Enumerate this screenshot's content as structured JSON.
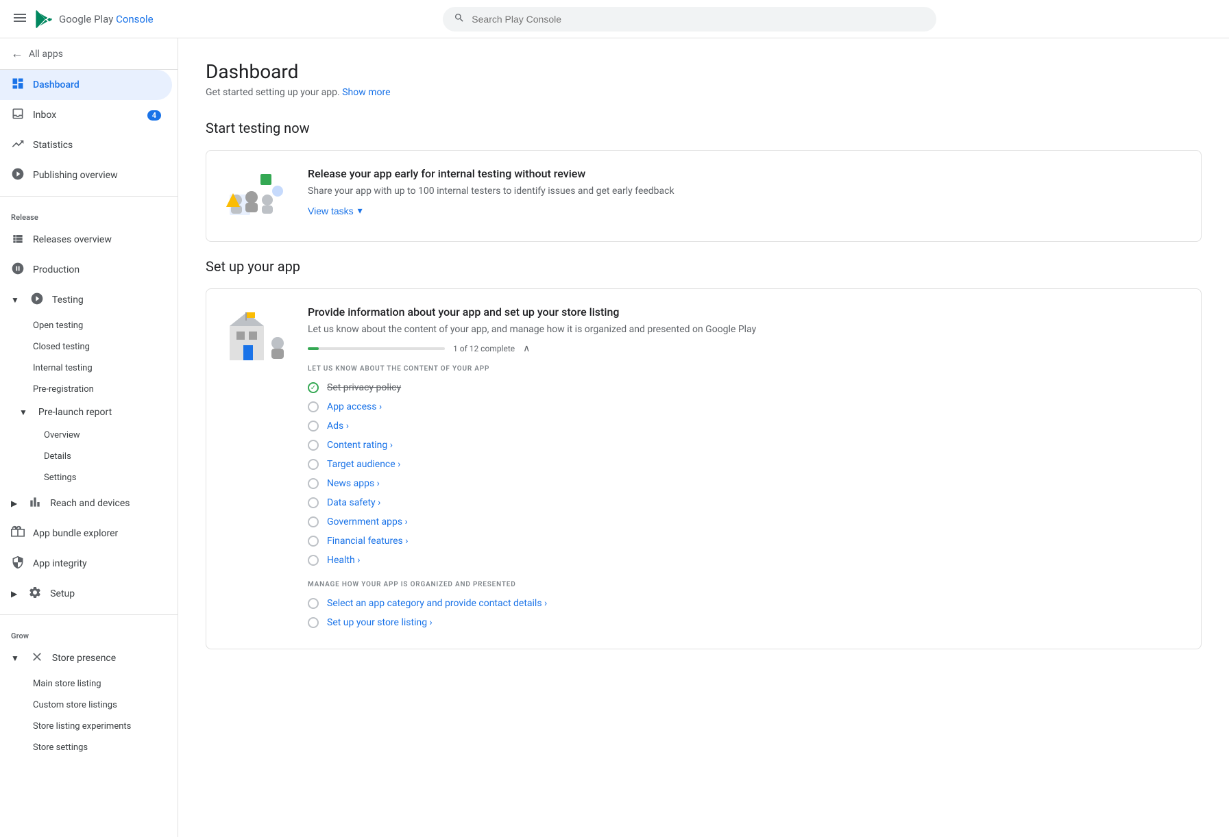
{
  "topbar": {
    "menu_label": "☰",
    "logo_prefix": "Google Play",
    "logo_suffix": "Console",
    "search_placeholder": "Search Play Console"
  },
  "sidebar": {
    "all_apps_label": "All apps",
    "nav_items": [
      {
        "id": "dashboard",
        "label": "Dashboard",
        "icon": "grid",
        "active": true
      },
      {
        "id": "inbox",
        "label": "Inbox",
        "icon": "inbox",
        "badge": "4"
      },
      {
        "id": "statistics",
        "label": "Statistics",
        "icon": "bar-chart"
      },
      {
        "id": "publishing-overview",
        "label": "Publishing overview",
        "icon": "clock"
      }
    ],
    "release_section": "Release",
    "release_items": [
      {
        "id": "releases-overview",
        "label": "Releases overview",
        "icon": "grid-small"
      },
      {
        "id": "production",
        "label": "Production",
        "icon": "rocket"
      },
      {
        "id": "testing",
        "label": "Testing",
        "icon": "play-circle",
        "expanded": true
      }
    ],
    "testing_sub_items": [
      "Open testing",
      "Closed testing",
      "Internal testing",
      "Pre-registration"
    ],
    "pre_launch_label": "Pre-launch report",
    "pre_launch_sub_items": [
      "Overview",
      "Details",
      "Settings"
    ],
    "reach_label": "Reach and devices",
    "app_bundle_label": "App bundle explorer",
    "app_integrity_label": "App integrity",
    "setup_label": "Setup",
    "grow_section": "Grow",
    "store_presence_label": "Store presence",
    "store_sub_items": [
      "Main store listing",
      "Custom store listings",
      "Store listing experiments",
      "Store settings"
    ]
  },
  "main": {
    "title": "Dashboard",
    "subtitle": "Get started setting up your app.",
    "show_more": "Show more",
    "start_testing_title": "Start testing now",
    "testing_card": {
      "title": "Release your app early for internal testing without review",
      "desc": "Share your app with up to 100 internal testers to identify issues and get early feedback",
      "view_tasks": "View tasks"
    },
    "setup_title": "Set up your app",
    "setup_card": {
      "title": "Provide information about your app and set up your store listing",
      "desc": "Let us know about the content of your app, and manage how it is organized and presented on Google Play",
      "progress_text": "1 of 12 complete",
      "progress_percent": 8,
      "section1_label": "LET US KNOW ABOUT THE CONTENT OF YOUR APP",
      "tasks1": [
        {
          "label": "Set privacy policy",
          "done": true
        },
        {
          "label": "App access",
          "done": false
        },
        {
          "label": "Ads",
          "done": false
        },
        {
          "label": "Content rating",
          "done": false
        },
        {
          "label": "Target audience",
          "done": false
        },
        {
          "label": "News apps",
          "done": false
        },
        {
          "label": "Data safety",
          "done": false
        },
        {
          "label": "Government apps",
          "done": false
        },
        {
          "label": "Financial features",
          "done": false
        },
        {
          "label": "Health",
          "done": false
        }
      ],
      "section2_label": "MANAGE HOW YOUR APP IS ORGANIZED AND PRESENTED",
      "tasks2": [
        {
          "label": "Select an app category and provide contact details",
          "done": false
        },
        {
          "label": "Set up your store listing",
          "done": false
        }
      ]
    }
  }
}
